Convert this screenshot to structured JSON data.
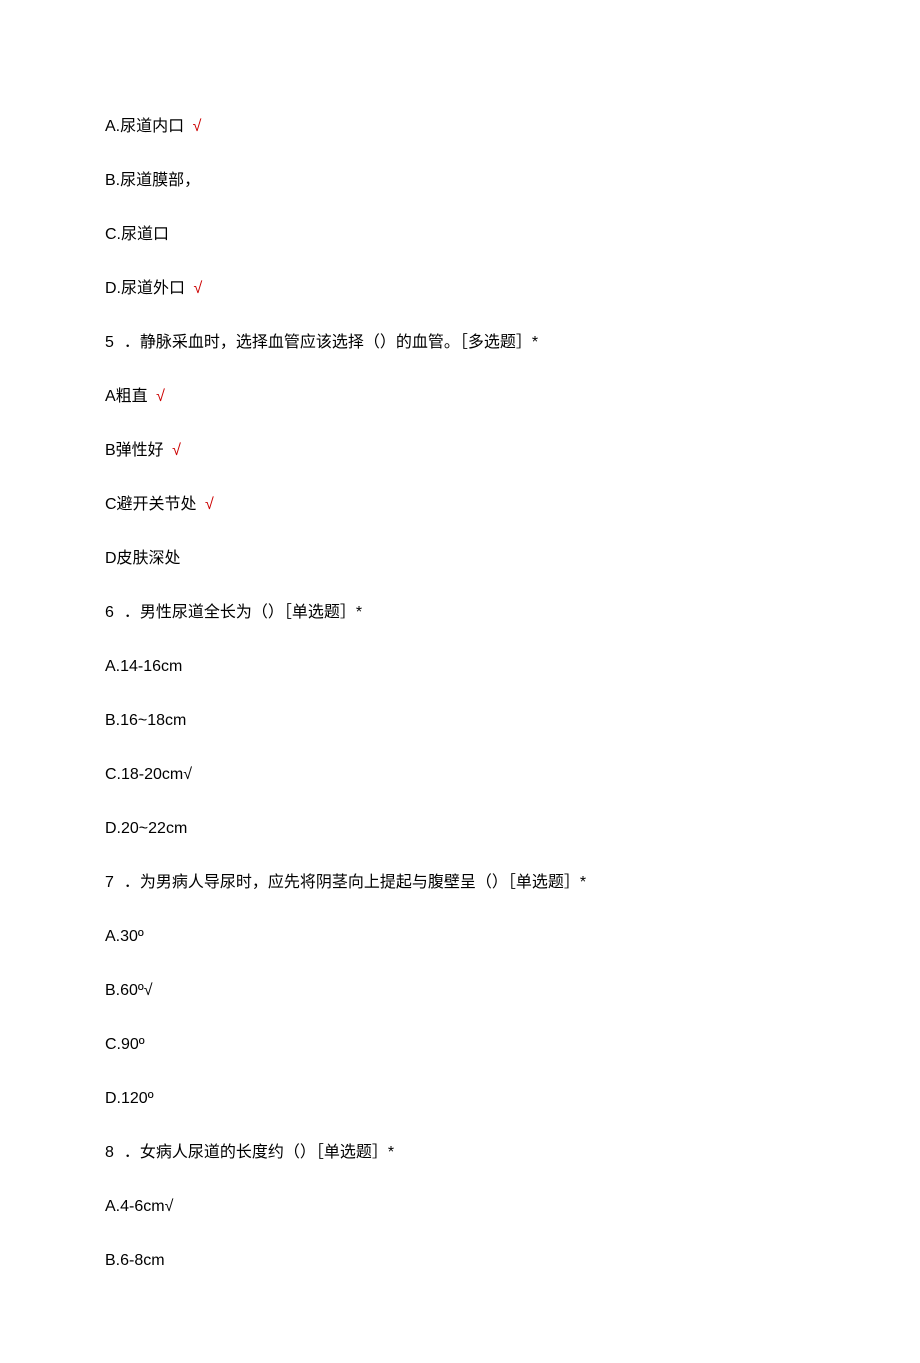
{
  "lines": [
    {
      "parts": [
        {
          "text": "A.尿道内口 "
        },
        {
          "text": " √",
          "check": true
        }
      ]
    },
    {
      "parts": [
        {
          "text": "B.尿道膜部，"
        }
      ]
    },
    {
      "parts": [
        {
          "text": "C.尿道口"
        }
      ]
    },
    {
      "parts": [
        {
          "text": "D.尿道外口"
        },
        {
          "text": " √",
          "check": true
        }
      ]
    },
    {
      "parts": [
        {
          "text": "5",
          "qnum": true
        },
        {
          "text": "．静脉采血时，选择血管应该选择（）的血管。［多选题］*"
        }
      ]
    },
    {
      "parts": [
        {
          "text": "A粗直"
        },
        {
          "text": " √",
          "check": true
        }
      ]
    },
    {
      "parts": [
        {
          "text": "B弹性好"
        },
        {
          "text": " √",
          "check": true
        }
      ]
    },
    {
      "parts": [
        {
          "text": "C避开关节处"
        },
        {
          "text": " √",
          "check": true
        }
      ]
    },
    {
      "parts": [
        {
          "text": "D皮肤深处"
        }
      ]
    },
    {
      "parts": [
        {
          "text": "6",
          "qnum": true
        },
        {
          "text": "．男性尿道全长为（）［单选题］*"
        }
      ]
    },
    {
      "parts": [
        {
          "text": "A.14-16cm"
        }
      ]
    },
    {
      "parts": [
        {
          "text": "B.16~18cm"
        }
      ]
    },
    {
      "parts": [
        {
          "text": "C.18-20cm√"
        }
      ]
    },
    {
      "parts": [
        {
          "text": "D.20~22cm"
        }
      ]
    },
    {
      "parts": [
        {
          "text": "7",
          "qnum": true
        },
        {
          "text": "．为男病人导尿时，应先将阴茎向上提起与腹壁呈（）［单选题］*"
        }
      ]
    },
    {
      "parts": [
        {
          "text": "A.30º"
        }
      ]
    },
    {
      "parts": [
        {
          "text": "B.60º√"
        }
      ]
    },
    {
      "parts": [
        {
          "text": "C.90º"
        }
      ]
    },
    {
      "parts": [
        {
          "text": "D.120º"
        }
      ]
    },
    {
      "parts": [
        {
          "text": "8",
          "qnum": true
        },
        {
          "text": "．女病人尿道的长度约（）［单选题］*"
        }
      ]
    },
    {
      "parts": [
        {
          "text": "A.4-6cm√"
        }
      ]
    },
    {
      "parts": [
        {
          "text": "B.6-8cm"
        }
      ]
    }
  ]
}
